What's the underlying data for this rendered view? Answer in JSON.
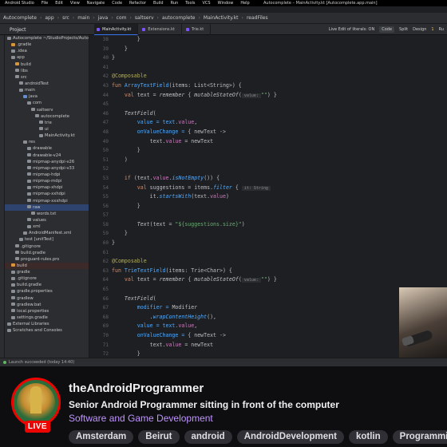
{
  "ide": {
    "menubar": {
      "items": [
        "Android Studio",
        "File",
        "Edit",
        "View",
        "Navigate",
        "Code",
        "Refactor",
        "Build",
        "Run",
        "Tools",
        "VCS",
        "Window",
        "Help"
      ],
      "window_title": "Autocomplete – MainActivity.kt [Autocomplete.app.main]"
    },
    "breadcrumb": [
      "Autocomplete",
      "app",
      "src",
      "main",
      "java",
      "com",
      "saltserv",
      "autocomplete",
      "MainActivity.kt",
      "readFiles"
    ],
    "project_header": "Project",
    "tabs": [
      {
        "label": "MainActivity.kt",
        "active": true
      },
      {
        "label": "Extensions.kt",
        "active": false
      },
      {
        "label": "Trie.kt",
        "active": false
      }
    ],
    "right_tools": {
      "live_edit": "Live Edit of literals: ON",
      "code": "Code",
      "split": "Split",
      "design": "Design",
      "warnings": "1",
      "misc": "Ru"
    },
    "tree": [
      {
        "label": "Autocomplete ~/StudioProjects/Autocomplete",
        "depth": 0,
        "icon": "folder"
      },
      {
        "label": ".gradle",
        "depth": 1,
        "icon": "folder-orange"
      },
      {
        "label": ".idea",
        "depth": 1,
        "icon": "folder"
      },
      {
        "label": "app",
        "depth": 1,
        "icon": "folder"
      },
      {
        "label": "build",
        "depth": 2,
        "icon": "folder-orange"
      },
      {
        "label": "libs",
        "depth": 2,
        "icon": "folder"
      },
      {
        "label": "src",
        "depth": 2,
        "icon": "folder"
      },
      {
        "label": "androidTest",
        "depth": 3,
        "icon": "folder"
      },
      {
        "label": "main",
        "depth": 3,
        "icon": "folder"
      },
      {
        "label": "java",
        "depth": 4,
        "icon": "folder-blue"
      },
      {
        "label": "com",
        "depth": 5,
        "icon": "folder"
      },
      {
        "label": "saltserv",
        "depth": 6,
        "icon": "folder"
      },
      {
        "label": "autocomplete",
        "depth": 7,
        "icon": "folder"
      },
      {
        "label": "trie",
        "depth": 8,
        "icon": "folder"
      },
      {
        "label": "ui",
        "depth": 8,
        "icon": "folder"
      },
      {
        "label": "MainActivity.kt",
        "depth": 8,
        "icon": "file"
      },
      {
        "label": "res",
        "depth": 4,
        "icon": "folder"
      },
      {
        "label": "drawable",
        "depth": 5,
        "icon": "folder"
      },
      {
        "label": "drawable-v24",
        "depth": 5,
        "icon": "folder"
      },
      {
        "label": "mipmap-anydpi-v26",
        "depth": 5,
        "icon": "folder"
      },
      {
        "label": "mipmap-anydpi-v33",
        "depth": 5,
        "icon": "folder"
      },
      {
        "label": "mipmap-hdpi",
        "depth": 5,
        "icon": "folder"
      },
      {
        "label": "mipmap-mdpi",
        "depth": 5,
        "icon": "folder"
      },
      {
        "label": "mipmap-xhdpi",
        "depth": 5,
        "icon": "folder"
      },
      {
        "label": "mipmap-xxhdpi",
        "depth": 5,
        "icon": "folder"
      },
      {
        "label": "mipmap-xxxhdpi",
        "depth": 5,
        "icon": "folder"
      },
      {
        "label": "raw",
        "depth": 5,
        "icon": "folder",
        "selected": true
      },
      {
        "label": "words.txt",
        "depth": 6,
        "icon": "file"
      },
      {
        "label": "values",
        "depth": 5,
        "icon": "folder"
      },
      {
        "label": "xml",
        "depth": 5,
        "icon": "folder"
      },
      {
        "label": "AndroidManifest.xml",
        "depth": 4,
        "icon": "file"
      },
      {
        "label": "test [unitTest]",
        "depth": 3,
        "icon": "folder"
      },
      {
        "label": ".gitignore",
        "depth": 2,
        "icon": "file"
      },
      {
        "label": "build.gradle",
        "depth": 2,
        "icon": "file"
      },
      {
        "label": "proguard-rules.pro",
        "depth": 2,
        "icon": "file"
      },
      {
        "label": "build",
        "depth": 1,
        "icon": "folder-orange",
        "highlight": true
      },
      {
        "label": "gradle",
        "depth": 1,
        "icon": "folder"
      },
      {
        "label": ".gitignore",
        "depth": 1,
        "icon": "file"
      },
      {
        "label": "build.gradle",
        "depth": 1,
        "icon": "file"
      },
      {
        "label": "gradle.properties",
        "depth": 1,
        "icon": "file"
      },
      {
        "label": "gradlew",
        "depth": 1,
        "icon": "file"
      },
      {
        "label": "gradlew.bat",
        "depth": 1,
        "icon": "file"
      },
      {
        "label": "local.properties",
        "depth": 1,
        "icon": "file"
      },
      {
        "label": "settings.gradle",
        "depth": 1,
        "icon": "file"
      },
      {
        "label": "External Libraries",
        "depth": 0,
        "icon": "folder"
      },
      {
        "label": "Scratches and Consoles",
        "depth": 0,
        "icon": "folder"
      }
    ],
    "line_numbers": [
      "38",
      "39",
      "40",
      "41",
      "42",
      "43",
      "44",
      "45",
      "46",
      "47",
      "48",
      "49",
      "50",
      "51",
      "52",
      "53",
      "54",
      "55",
      "56",
      "57",
      "58",
      "59",
      "60",
      "61",
      "62",
      "63",
      "64",
      "65",
      "66",
      "67",
      "68",
      "69",
      "70",
      "71",
      "72",
      "73"
    ],
    "code_lines": [
      [
        {
          "t": "        }",
          "c": ""
        }
      ],
      [
        {
          "t": "    }",
          "c": ""
        }
      ],
      [
        {
          "t": "}",
          "c": ""
        }
      ],
      [
        {
          "t": "",
          "c": ""
        }
      ],
      [
        {
          "t": "@Composable",
          "c": "ann"
        }
      ],
      [
        {
          "t": "fun ",
          "c": "kw"
        },
        {
          "t": "ArrayTextField",
          "c": "fn"
        },
        {
          "t": "(items: List<String>) {",
          "c": ""
        }
      ],
      [
        {
          "t": "    ",
          "c": ""
        },
        {
          "t": "val ",
          "c": "kw"
        },
        {
          "t": "text = ",
          "c": ""
        },
        {
          "t": "remember",
          "c": "it"
        },
        {
          "t": " { ",
          "c": ""
        },
        {
          "t": "mutableStateOf",
          "c": "it"
        },
        {
          "t": "(",
          "c": ""
        },
        {
          "t": " value: ",
          "c": "hint"
        },
        {
          "t": "\"\"",
          "c": "str"
        },
        {
          "t": ") }",
          "c": ""
        }
      ],
      [
        {
          "t": "",
          "c": ""
        }
      ],
      [
        {
          "t": "    TextField",
          "c": "it"
        },
        {
          "t": "(",
          "c": ""
        }
      ],
      [
        {
          "t": "        value = text.",
          "c": "fn"
        },
        {
          "t": "value",
          "c": "prop"
        },
        {
          "t": ",",
          "c": ""
        }
      ],
      [
        {
          "t": "        onValueChange = ",
          "c": "fn"
        },
        {
          "t": "{ newText ->",
          "c": ""
        }
      ],
      [
        {
          "t": "            text.",
          "c": ""
        },
        {
          "t": "value",
          "c": "prop"
        },
        {
          "t": " = newText",
          "c": ""
        }
      ],
      [
        {
          "t": "        }",
          "c": ""
        }
      ],
      [
        {
          "t": "    )",
          "c": ""
        }
      ],
      [
        {
          "t": "",
          "c": ""
        }
      ],
      [
        {
          "t": "    ",
          "c": ""
        },
        {
          "t": "if ",
          "c": "kw"
        },
        {
          "t": "(text.",
          "c": ""
        },
        {
          "t": "value",
          "c": "prop"
        },
        {
          "t": ".",
          "c": ""
        },
        {
          "t": "isNotEmpty",
          "c": "ufn"
        },
        {
          "t": "()) {",
          "c": ""
        }
      ],
      [
        {
          "t": "        ",
          "c": ""
        },
        {
          "t": "val ",
          "c": "kw"
        },
        {
          "t": "suggestions = items.",
          "c": ""
        },
        {
          "t": "filter",
          "c": "ufn"
        },
        {
          "t": " { ",
          "c": ""
        },
        {
          "t": " it: String ",
          "c": "hint"
        }
      ],
      [
        {
          "t": "            it.",
          "c": ""
        },
        {
          "t": "startsWith",
          "c": "ufn"
        },
        {
          "t": "(text.",
          "c": ""
        },
        {
          "t": "value",
          "c": "prop"
        },
        {
          "t": ")",
          "c": ""
        }
      ],
      [
        {
          "t": "        }",
          "c": ""
        }
      ],
      [
        {
          "t": "",
          "c": ""
        }
      ],
      [
        {
          "t": "        Text",
          "c": "it"
        },
        {
          "t": "(text = ",
          "c": ""
        },
        {
          "t": "\"${suggestions.size}\"",
          "c": "str"
        },
        {
          "t": ")",
          "c": ""
        }
      ],
      [
        {
          "t": "    }",
          "c": ""
        }
      ],
      [
        {
          "t": "}",
          "c": ""
        }
      ],
      [
        {
          "t": "",
          "c": ""
        }
      ],
      [
        {
          "t": "@Composable",
          "c": "ann"
        }
      ],
      [
        {
          "t": "fun ",
          "c": "kw"
        },
        {
          "t": "TrieTextField",
          "c": "fn"
        },
        {
          "t": "(items: Trie<Char>) {",
          "c": ""
        }
      ],
      [
        {
          "t": "    ",
          "c": ""
        },
        {
          "t": "val ",
          "c": "kw"
        },
        {
          "t": "text = ",
          "c": ""
        },
        {
          "t": "remember",
          "c": "it"
        },
        {
          "t": " { ",
          "c": ""
        },
        {
          "t": "mutableStateOf",
          "c": "it"
        },
        {
          "t": "(",
          "c": ""
        },
        {
          "t": " value: ",
          "c": "hint"
        },
        {
          "t": "\"\"",
          "c": "str"
        },
        {
          "t": ") }",
          "c": ""
        }
      ],
      [
        {
          "t": "",
          "c": ""
        }
      ],
      [
        {
          "t": "    TextField",
          "c": "it"
        },
        {
          "t": "(",
          "c": ""
        }
      ],
      [
        {
          "t": "        modifier = ",
          "c": "fn"
        },
        {
          "t": "Modifier",
          "c": ""
        }
      ],
      [
        {
          "t": "            .",
          "c": ""
        },
        {
          "t": "wrapContentHeight",
          "c": "ufn"
        },
        {
          "t": "(),",
          "c": ""
        }
      ],
      [
        {
          "t": "        value = text.",
          "c": "fn"
        },
        {
          "t": "value",
          "c": "prop"
        },
        {
          "t": ",",
          "c": ""
        }
      ],
      [
        {
          "t": "        onValueChange = ",
          "c": "fn"
        },
        {
          "t": "{ newText ->",
          "c": ""
        }
      ],
      [
        {
          "t": "            text.",
          "c": ""
        },
        {
          "t": "value",
          "c": "prop"
        },
        {
          "t": " = newText",
          "c": ""
        }
      ],
      [
        {
          "t": "        }",
          "c": ""
        }
      ],
      [
        {
          "t": "    )",
          "c": ""
        }
      ]
    ],
    "status": "Launch succeeded (today 14:40)"
  },
  "stream": {
    "channel_name": "theAndroidProgrammer",
    "stream_title": "Senior Android Programmer sitting in front of the computer",
    "category": "Software and Game Development",
    "live_badge": "LIVE",
    "tags": [
      "Amsterdam",
      "Beirut",
      "android",
      "AndroidDevelopment",
      "kotlin",
      "Programming"
    ]
  },
  "colors": {
    "live_red": "#eb0400",
    "category_purple": "#bf94ff",
    "ide_bg": "#1e1f22",
    "selection": "#2e436e"
  }
}
